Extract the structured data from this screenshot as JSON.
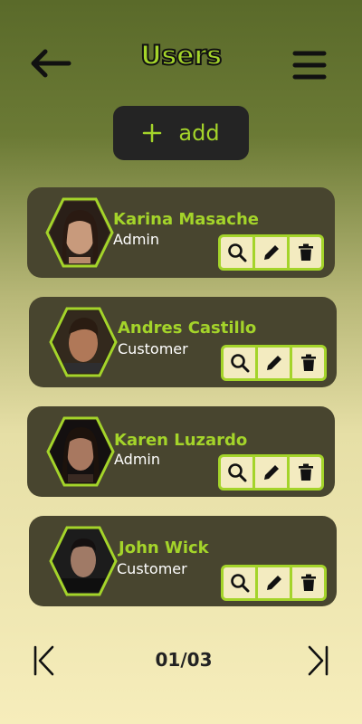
{
  "header": {
    "title": "Users",
    "back_icon": "arrow-left-icon",
    "menu_icon": "hamburger-menu-icon"
  },
  "add_button": {
    "icon": "plus-icon",
    "label": "add"
  },
  "users": [
    {
      "name": "Karina Masache",
      "role": "Admin"
    },
    {
      "name": "Andres Castillo",
      "role": "Customer"
    },
    {
      "name": "Karen Luzardo",
      "role": "Admin"
    },
    {
      "name": "John Wick",
      "role": "Customer"
    }
  ],
  "row_actions": [
    "search-icon",
    "pencil-icon",
    "trash-icon"
  ],
  "pagination": {
    "label": "01/03",
    "first_icon": "first-page-icon",
    "last_icon": "last-page-icon"
  },
  "colors": {
    "accent": "#a4d42a",
    "card": "#48452f",
    "action_bg": "#f3ebc0",
    "text_dark": "#111111"
  }
}
